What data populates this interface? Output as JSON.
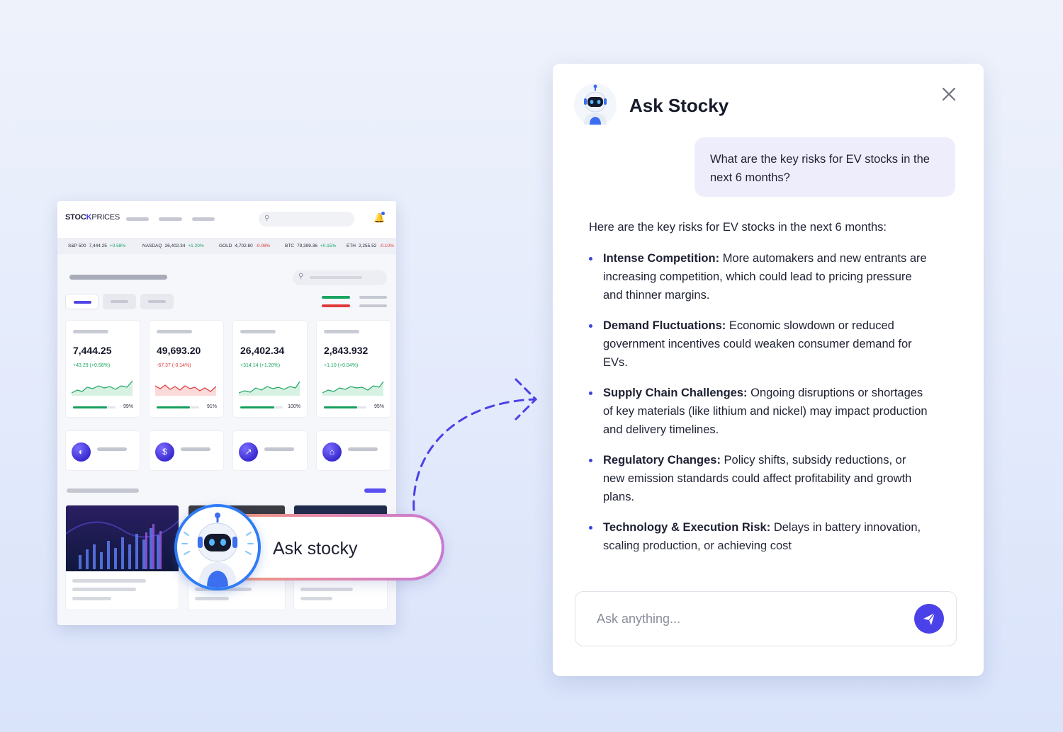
{
  "dashboard": {
    "logo": {
      "part1": "STOC",
      "part2": "K",
      "part3": "PRICES"
    },
    "ticker": [
      {
        "name": "S&P 500",
        "value": "7,444.25",
        "change": "+0.58%",
        "dir": "up"
      },
      {
        "name": "NASDAQ",
        "value": "26,402.34",
        "change": "+1.20%",
        "dir": "up"
      },
      {
        "name": "GOLD",
        "value": "4,702.80",
        "change": "-0.08%",
        "dir": "down"
      },
      {
        "name": "BTC",
        "value": "79,399.36",
        "change": "+0.15%",
        "dir": "up"
      },
      {
        "name": "ETH",
        "value": "2,255.52",
        "change": "-0.10%",
        "dir": "down"
      }
    ],
    "stat_cards": [
      {
        "value": "7,444.25",
        "change": "+43.29 (+0.58%)",
        "dir": "up",
        "percent": "99%",
        "progress": 0.8
      },
      {
        "value": "49,693.20",
        "change": "-67.37 (-0.14%)",
        "dir": "down",
        "percent": "91%",
        "progress": 0.78
      },
      {
        "value": "26,402.34",
        "change": "+314.14 (+1.20%)",
        "dir": "up",
        "percent": "100%",
        "progress": 0.8
      },
      {
        "value": "2,843.932",
        "change": "+1.10 (+0.04%)",
        "dir": "up",
        "percent": "95%",
        "progress": 0.78
      }
    ],
    "mini_card_icons": [
      "coin-icon",
      "hand-dollar-icon",
      "growth-chart-icon",
      "bank-icon"
    ],
    "ask_pill_label": "Ask stocky"
  },
  "chat": {
    "title": "Ask Stocky",
    "user_message": "What are the key risks for EV stocks in the next 6 months?",
    "bot_intro": "Here are the key risks for EV stocks in the next 6 months:",
    "risks": [
      {
        "title": "Intense Competition:",
        "text": "More automakers and new entrants are increasing competition, which could lead to pricing pressure and thinner margins."
      },
      {
        "title": "Demand Fluctuations:",
        "text": "Economic slowdown or reduced government incentives could weaken consumer demand for EVs."
      },
      {
        "title": "Supply Chain Challenges:",
        "text": "Ongoing disruptions or shortages of key materials (like lithium and nickel) may impact production and delivery timelines."
      },
      {
        "title": "Regulatory Changes:",
        "text": "Policy shifts, subsidy reductions, or new emission standards could affect profitability and growth plans."
      },
      {
        "title": "Technology & Execution Risk:",
        "text": "Delays in battery innovation, scaling production, or achieving cost"
      }
    ],
    "input_placeholder": "Ask anything...",
    "colors": {
      "accent": "#4b41e8",
      "user_bubble": "#eeedfc",
      "up": "#1aa560",
      "down": "#e0393a"
    }
  }
}
